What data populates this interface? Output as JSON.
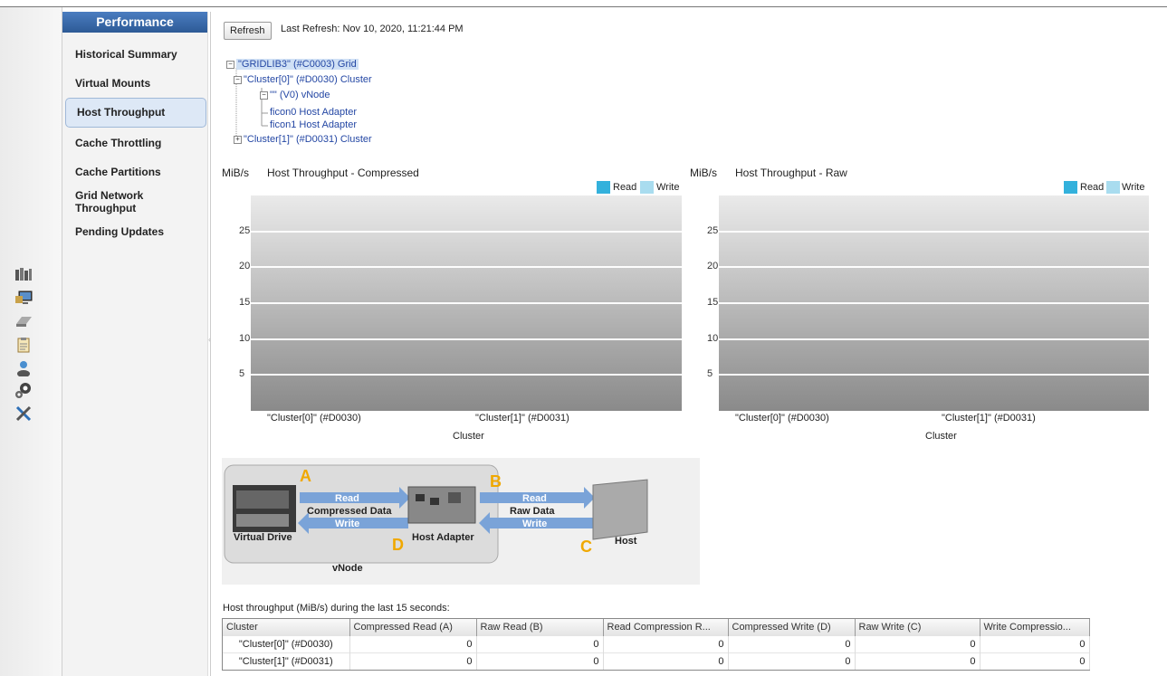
{
  "sidebar": {
    "title": "Performance",
    "items": [
      {
        "label": "Historical Summary"
      },
      {
        "label": "Virtual Mounts"
      },
      {
        "label": "Host Throughput"
      },
      {
        "label": "Cache Throttling"
      },
      {
        "label": "Cache Partitions"
      },
      {
        "label": "Grid Network Throughput"
      },
      {
        "label": "Pending Updates"
      }
    ],
    "selected": "Host Throughput"
  },
  "rail_icons": [
    "grid-icon",
    "monitor-icon",
    "drive-icon",
    "clipboard-icon",
    "user-icon",
    "gears-icon",
    "tools-icon"
  ],
  "toolbar": {
    "refresh_label": "Refresh",
    "last_refresh": "Last Refresh:  Nov 10, 2020, 11:21:44 PM"
  },
  "tree": {
    "grid": "\"GRIDLIB3\" (#C0003) Grid",
    "cluster0": "\"Cluster[0]\" (#D0030) Cluster",
    "vnode": "\"\" (V0) vNode",
    "ficon0": "ficon0 Host Adapter",
    "ficon1": "ficon1 Host Adapter",
    "cluster1": "\"Cluster[1]\" (#D0031) Cluster"
  },
  "colors": {
    "read": "#33b1dc",
    "write": "#a9dcef",
    "accent": "#2d5a96"
  },
  "chart_data": [
    {
      "type": "bar",
      "title": "Host Throughput - Compressed",
      "ylabel": "MiB/s",
      "xlabel": "Cluster",
      "categories": [
        "\"Cluster[0]\" (#D0030)",
        "\"Cluster[1]\" (#D0031)"
      ],
      "series": [
        {
          "name": "Read",
          "values": [
            0,
            0
          ]
        },
        {
          "name": "Write",
          "values": [
            0,
            0
          ]
        }
      ],
      "ylim": [
        0,
        30
      ],
      "yticks": [
        5,
        10,
        15,
        20,
        25
      ],
      "legend": "top-right",
      "grid": true
    },
    {
      "type": "bar",
      "title": "Host Throughput - Raw",
      "ylabel": "MiB/s",
      "xlabel": "Cluster",
      "categories": [
        "\"Cluster[0]\" (#D0030)",
        "\"Cluster[1]\" (#D0031)"
      ],
      "series": [
        {
          "name": "Read",
          "values": [
            0,
            0
          ]
        },
        {
          "name": "Write",
          "values": [
            0,
            0
          ]
        }
      ],
      "ylim": [
        0,
        30
      ],
      "yticks": [
        5,
        10,
        15,
        20,
        25
      ],
      "legend": "top-right",
      "grid": true
    }
  ],
  "diagram": {
    "label_a": "A",
    "label_b": "B",
    "label_c": "C",
    "label_d": "D",
    "read1": "Read",
    "compressed_data": "Compressed Data",
    "write1": "Write",
    "read2": "Read",
    "raw_data": "Raw Data",
    "write2": "Write",
    "virtual_drive": "Virtual Drive",
    "host_adapter": "Host Adapter",
    "host": "Host",
    "vnode": "vNode"
  },
  "table": {
    "caption": "Host throughput (MiB/s) during the last 15 seconds:",
    "columns": [
      "Cluster",
      "Compressed Read (A)",
      "Raw Read (B)",
      "Read Compression R...",
      "Compressed Write (D)",
      "Raw Write (C)",
      "Write Compressio..."
    ],
    "rows": [
      [
        "\"Cluster[0]\" (#D0030)",
        "0",
        "0",
        "0",
        "0",
        "0",
        "0"
      ],
      [
        "\"Cluster[1]\" (#D0031)",
        "0",
        "0",
        "0",
        "0",
        "0",
        "0"
      ]
    ]
  }
}
